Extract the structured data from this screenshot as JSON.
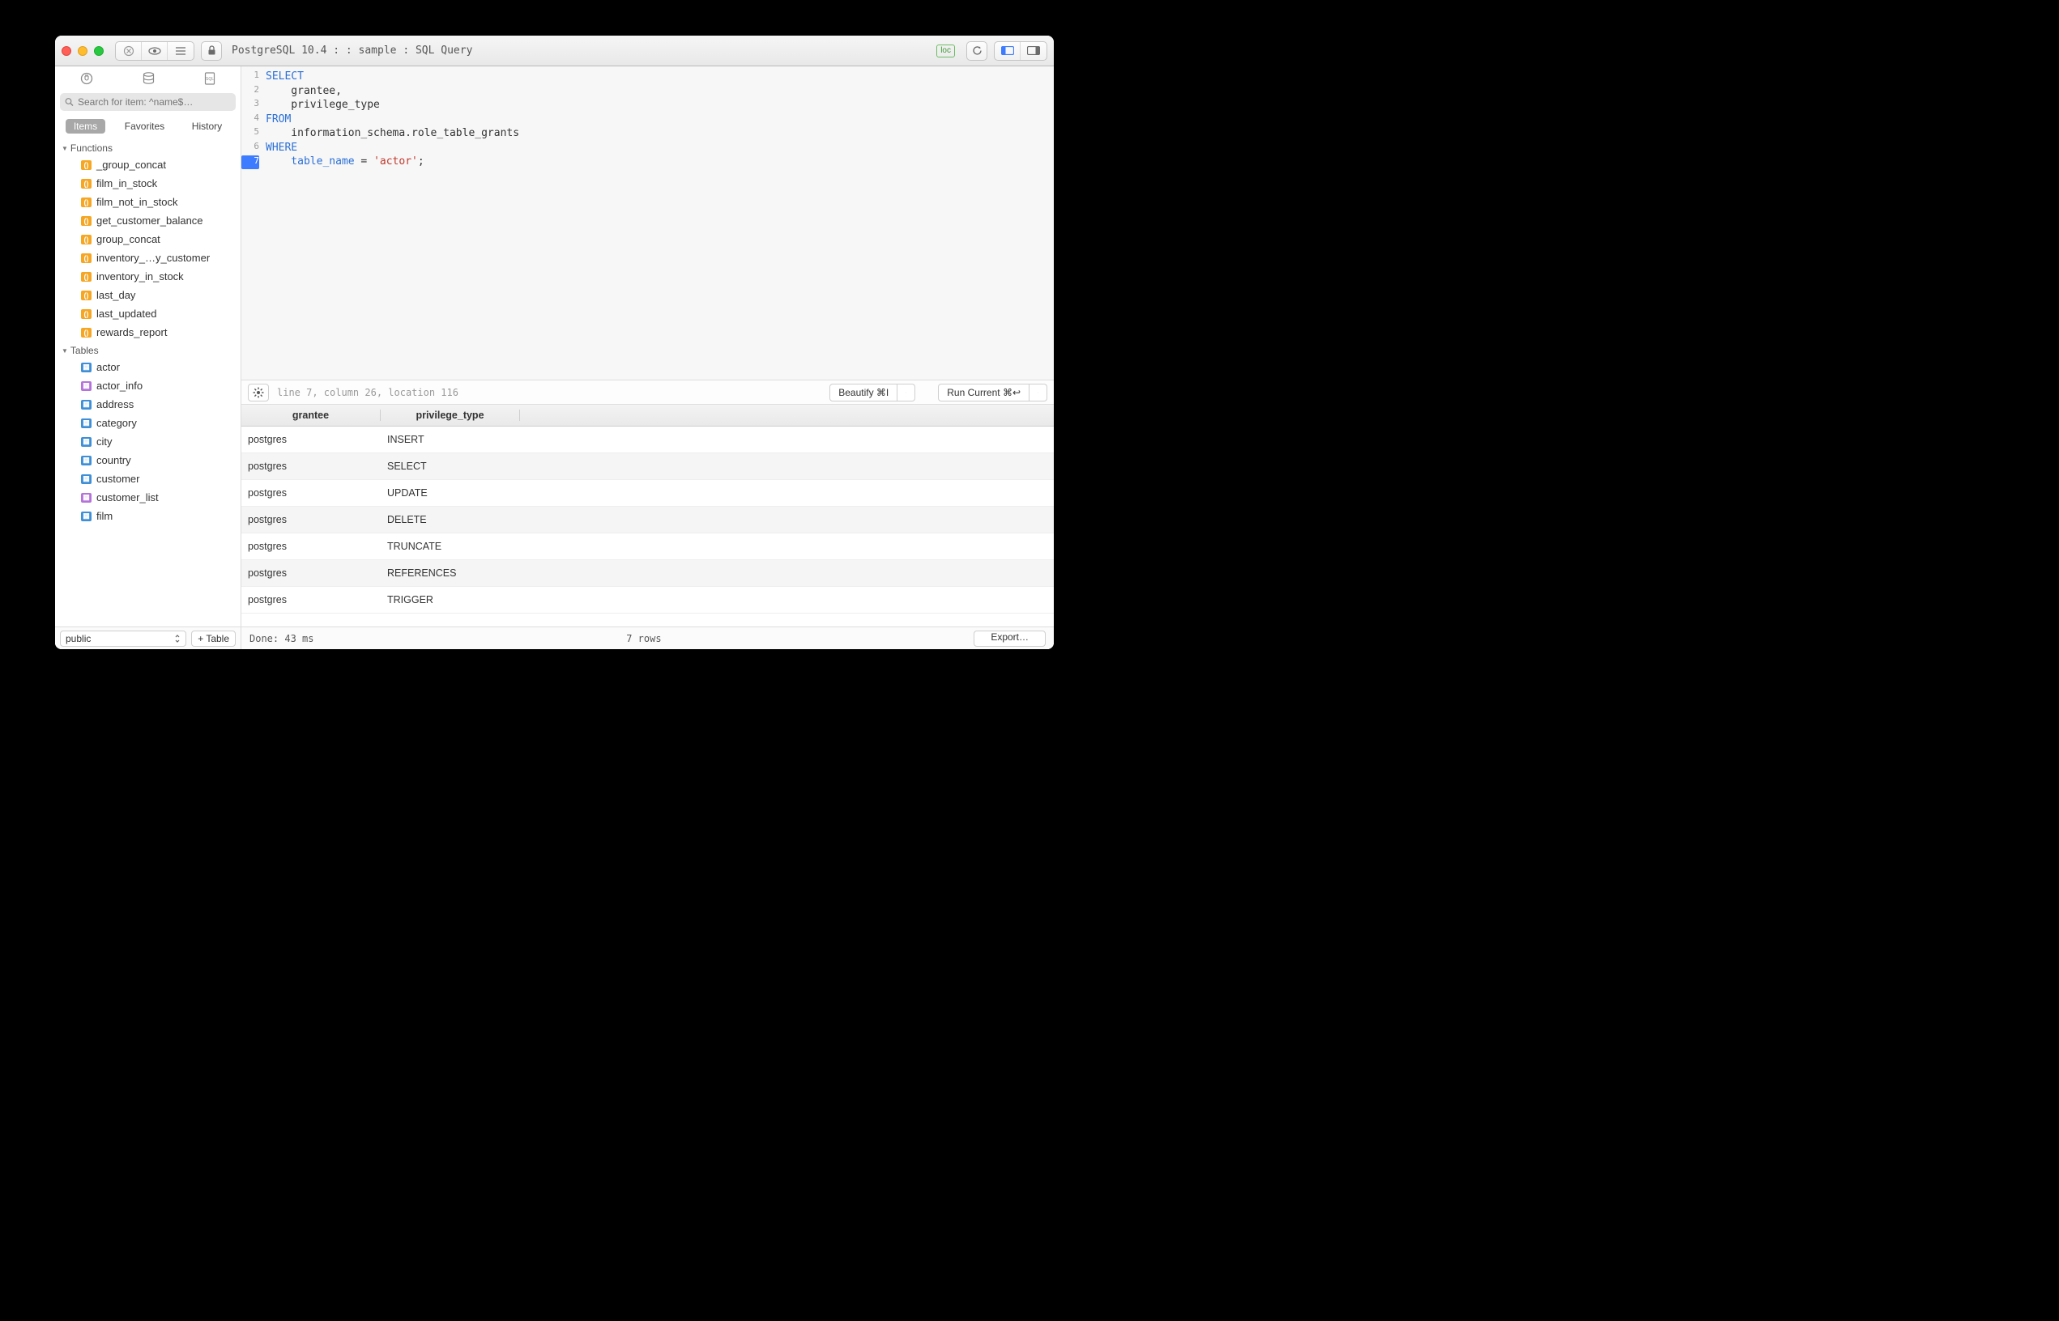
{
  "window_title": "PostgreSQL 10.4 :  : sample : SQL Query",
  "badge": "loc",
  "search_placeholder": "Search for item: ^name$…",
  "side_tabs": {
    "items": "Items",
    "favorites": "Favorites",
    "history": "History"
  },
  "groups": {
    "functions_label": "Functions",
    "tables_label": "Tables"
  },
  "functions": [
    "_group_concat",
    "film_in_stock",
    "film_not_in_stock",
    "get_customer_balance",
    "group_concat",
    "inventory_…y_customer",
    "inventory_in_stock",
    "last_day",
    "last_updated",
    "rewards_report"
  ],
  "tables": [
    {
      "name": "actor",
      "kind": "table"
    },
    {
      "name": "actor_info",
      "kind": "view"
    },
    {
      "name": "address",
      "kind": "table"
    },
    {
      "name": "category",
      "kind": "table"
    },
    {
      "name": "city",
      "kind": "table"
    },
    {
      "name": "country",
      "kind": "table"
    },
    {
      "name": "customer",
      "kind": "table"
    },
    {
      "name": "customer_list",
      "kind": "view"
    },
    {
      "name": "film",
      "kind": "table"
    }
  ],
  "schema_selector": "public",
  "add_table_label": "Table",
  "sql_lines": [
    {
      "n": 1,
      "tokens": [
        {
          "t": "SELECT",
          "c": "kw"
        }
      ]
    },
    {
      "n": 2,
      "tokens": [
        {
          "t": "    grantee,",
          "c": ""
        }
      ]
    },
    {
      "n": 3,
      "tokens": [
        {
          "t": "    privilege_type",
          "c": ""
        }
      ]
    },
    {
      "n": 4,
      "tokens": [
        {
          "t": "FROM",
          "c": "kw"
        }
      ]
    },
    {
      "n": 5,
      "tokens": [
        {
          "t": "    information_schema.role_table_grants",
          "c": ""
        }
      ]
    },
    {
      "n": 6,
      "tokens": [
        {
          "t": "WHERE",
          "c": "kw"
        }
      ]
    },
    {
      "n": 7,
      "tokens": [
        {
          "t": "    table_name",
          "c": "kw"
        },
        {
          "t": " = ",
          "c": ""
        },
        {
          "t": "'actor'",
          "c": "str"
        },
        {
          "t": ";",
          "c": ""
        }
      ]
    }
  ],
  "current_line": 7,
  "cursor_status": "line 7, column 26, location 116",
  "beautify_label": "Beautify ⌘I",
  "run_label": "Run Current ⌘↩",
  "columns": [
    "grantee",
    "privilege_type"
  ],
  "rows": [
    {
      "grantee": "postgres",
      "privilege_type": "INSERT"
    },
    {
      "grantee": "postgres",
      "privilege_type": "SELECT"
    },
    {
      "grantee": "postgres",
      "privilege_type": "UPDATE"
    },
    {
      "grantee": "postgres",
      "privilege_type": "DELETE"
    },
    {
      "grantee": "postgres",
      "privilege_type": "TRUNCATE"
    },
    {
      "grantee": "postgres",
      "privilege_type": "REFERENCES"
    },
    {
      "grantee": "postgres",
      "privilege_type": "TRIGGER"
    }
  ],
  "status_done": "Done:  43 ms",
  "status_rows": "7 rows",
  "export_label": "Export…"
}
